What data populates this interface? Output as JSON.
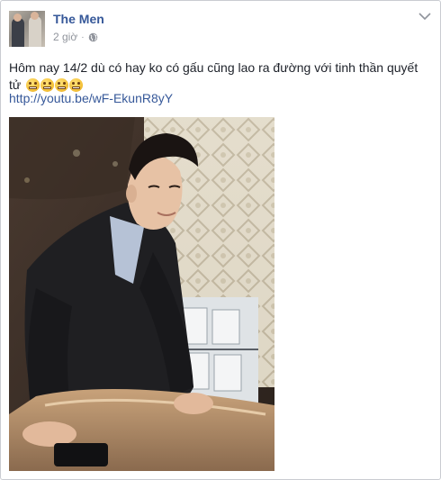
{
  "post": {
    "author": "The Men",
    "timestamp": "2 giờ",
    "separator": "·",
    "privacy_icon": "globe-icon",
    "options_icon": "chevron-down-icon",
    "text": "Hôm nay 14/2 dù có hay ko có gấu cũng lao ra đường với tinh thần quyết tử",
    "emoji_icon": "tired-face-emoji",
    "emoji_count": 4,
    "link": "http://youtu.be/wF-EkunR8yY",
    "photo_description_icon": "photo-icon"
  },
  "colors": {
    "author": "#365899",
    "link": "#365899",
    "meta": "#90949c",
    "border": "#c9ccd1",
    "text": "#1d2129"
  }
}
